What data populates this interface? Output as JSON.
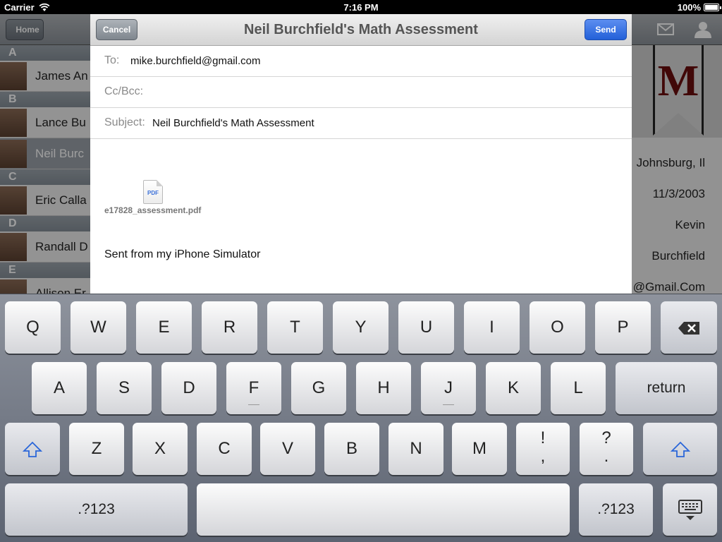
{
  "status_bar": {
    "carrier": "Carrier",
    "time": "7:16 PM",
    "battery": "100%"
  },
  "background": {
    "home_label": "Home",
    "sections": [
      {
        "letter": "A",
        "items": [
          {
            "name": "James An"
          }
        ]
      },
      {
        "letter": "B",
        "items": [
          {
            "name": "Lance Bu"
          },
          {
            "name": "Neil Burc",
            "selected": true
          }
        ]
      },
      {
        "letter": "C",
        "items": [
          {
            "name": "Eric Calla"
          }
        ]
      },
      {
        "letter": "D",
        "items": [
          {
            "name": "Randall D"
          }
        ]
      },
      {
        "letter": "E",
        "items": [
          {
            "name": "Allison Er"
          }
        ]
      }
    ],
    "ribbon_letter": "M",
    "details": [
      "Johnsburg, Il",
      "11/3/2003",
      "Kevin",
      "Burchfield",
      "@Gmail.Com"
    ]
  },
  "compose": {
    "title": "Neil Burchfield's Math Assessment",
    "cancel_label": "Cancel",
    "send_label": "Send",
    "to_label": "To:",
    "to_value": "mike.burchfield@gmail.com",
    "ccbcc_label": "Cc/Bcc:",
    "subject_label": "Subject:",
    "subject_value": "Neil Burchfield's Math Assessment",
    "attachment": {
      "icon_text": "PDF",
      "filename": "e17828_assessment.pdf"
    },
    "signature": "Sent from my iPhone Simulator"
  },
  "keyboard": {
    "row1": [
      "Q",
      "W",
      "E",
      "R",
      "T",
      "Y",
      "U",
      "I",
      "O",
      "P"
    ],
    "row2": [
      "A",
      "S",
      "D",
      "F",
      "G",
      "H",
      "J",
      "K",
      "L"
    ],
    "row3": [
      "Z",
      "X",
      "C",
      "V",
      "B",
      "N",
      "M"
    ],
    "return_label": "return",
    "punct1": {
      "top": "!",
      "bottom": ","
    },
    "punct2": {
      "top": "?",
      "bottom": "."
    },
    "numbers_label": ".?123",
    "accent_color": "#2a66d9"
  }
}
